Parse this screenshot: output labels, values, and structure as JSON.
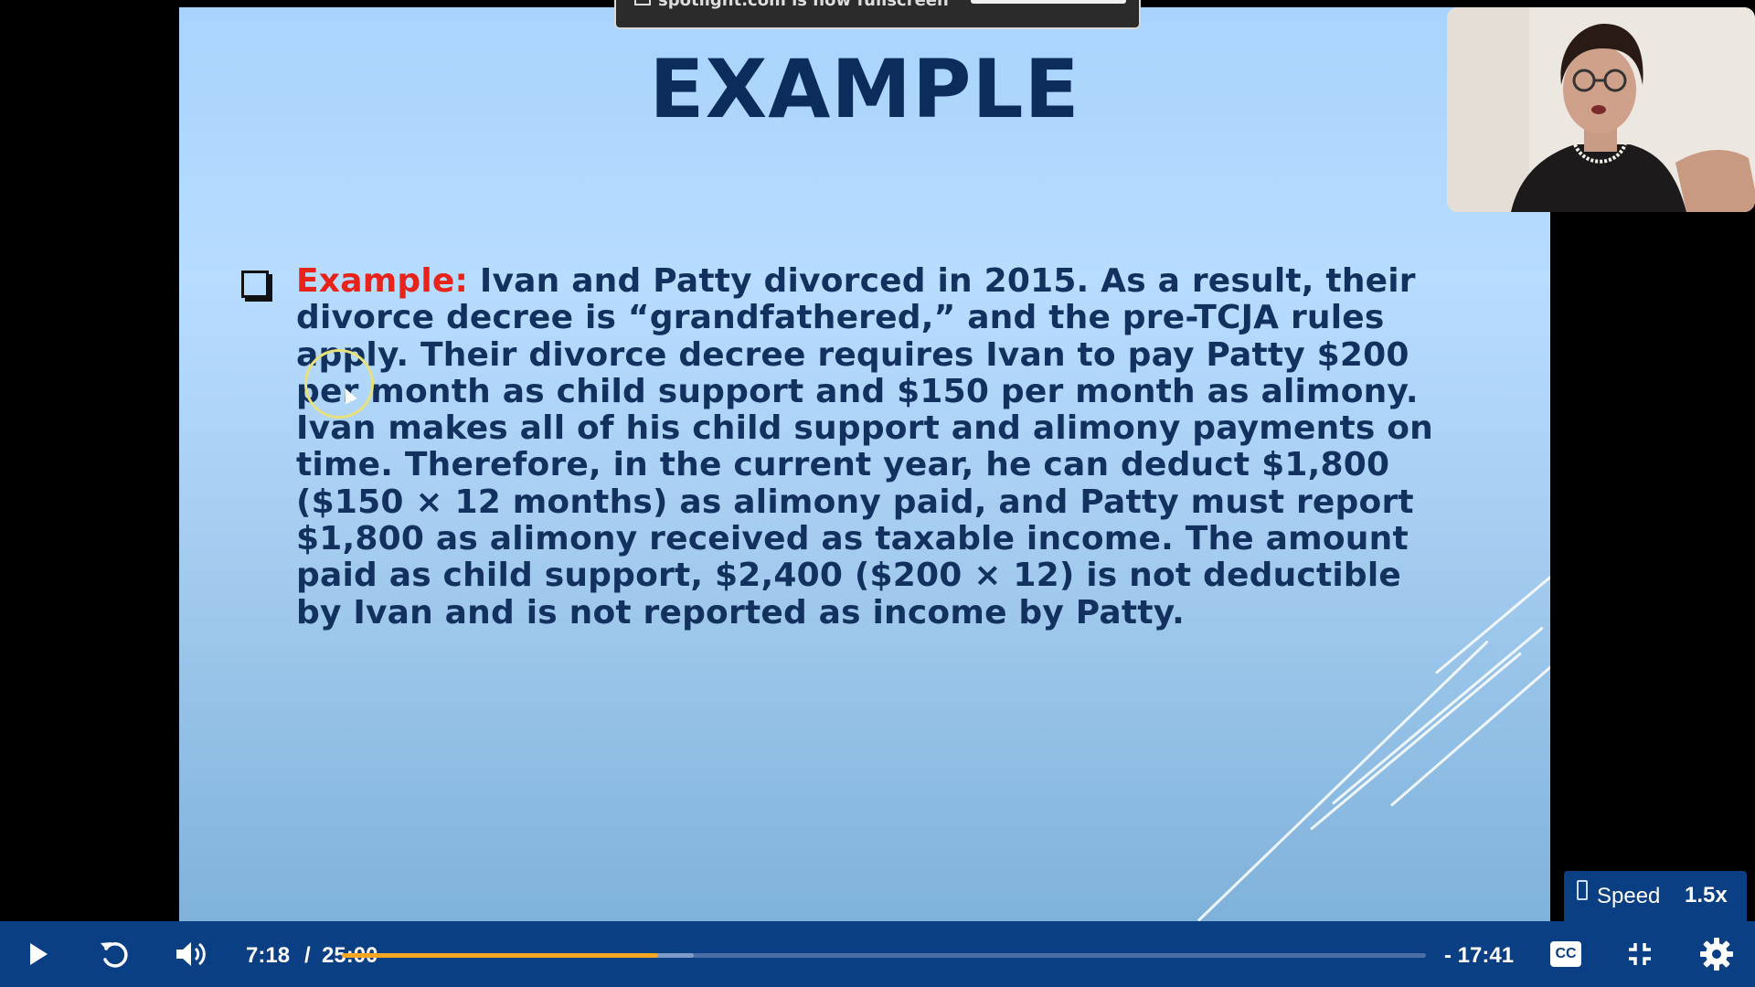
{
  "slide": {
    "title": "EXAMPLE",
    "label": "Example:",
    "body": " Ivan and Patty divorced in 2015. As a result, their divorce decree is “grandfathered,” and the pre-TCJA rules apply. Their divorce decree requires Ivan to pay Patty $200 per month as child support and $150 per month as alimony. Ivan makes all of his child support and alimony payments on time. Therefore, in the current year, he can deduct $1,800 ($150 × 12 months) as alimony paid, and Patty must report $1,800 as alimony received as taxable income. The amount paid as child support, $2,400 ($200 × 12) is not deductible by Ivan and is not reported as income by Patty.",
    "label_color": "#e8231a",
    "text_color": "#13315e"
  },
  "share_notice": {
    "text": "spotlight.com is now fullscreen"
  },
  "speed": {
    "label": "Speed",
    "value": "1.5x"
  },
  "player": {
    "time_current": "7:18",
    "time_separator": "/",
    "time_total": "25:00",
    "time_remaining": "- 17:41",
    "progress_fraction": 0.292,
    "buffered_fraction": 0.325,
    "accent_color": "#f5a623",
    "bar_color": "#0b3f84",
    "icons": [
      "play-icon",
      "replay-icon",
      "volume-icon",
      "cc-icon",
      "exit-fullscreen-icon",
      "settings-icon"
    ]
  }
}
